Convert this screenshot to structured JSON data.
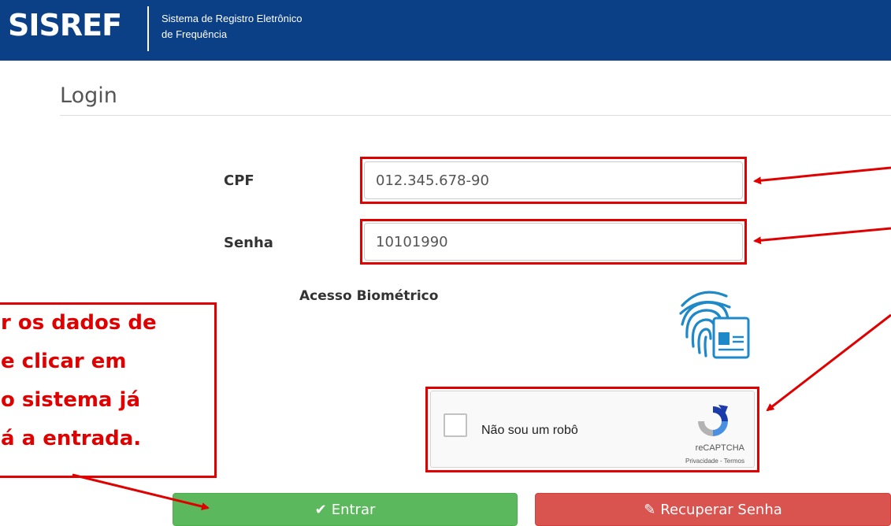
{
  "header": {
    "logo_text": "SISREF",
    "subtitle_line1": "Sistema de Registro Eletrônico",
    "subtitle_line2": "de Frequência",
    "bg_color": "#0b3f86"
  },
  "page": {
    "title": "Login"
  },
  "form": {
    "cpf_label": "CPF",
    "cpf_value": "012.345.678-90",
    "senha_label": "Senha",
    "senha_value": "10101990",
    "bio_label": "Acesso Biométrico"
  },
  "captcha": {
    "label": "Não sou um robô",
    "brand": "reCAPTCHA",
    "links": "Privacidade - Termos"
  },
  "buttons": {
    "entrar": "Entrar",
    "recuperar": "Recuperar Senha",
    "entrar_color": "#5cb85c",
    "recuperar_color": "#d9534f"
  },
  "annotation": {
    "lines": [
      "r os dados de",
      "e   clicar   em",
      "o sistema já",
      "á a entrada."
    ],
    "color": "#e00000"
  },
  "icons": {
    "check": "check-icon",
    "pencil": "pencil-icon",
    "fingerprint": "fingerprint-icon",
    "recaptcha": "recaptcha-logo-icon"
  }
}
